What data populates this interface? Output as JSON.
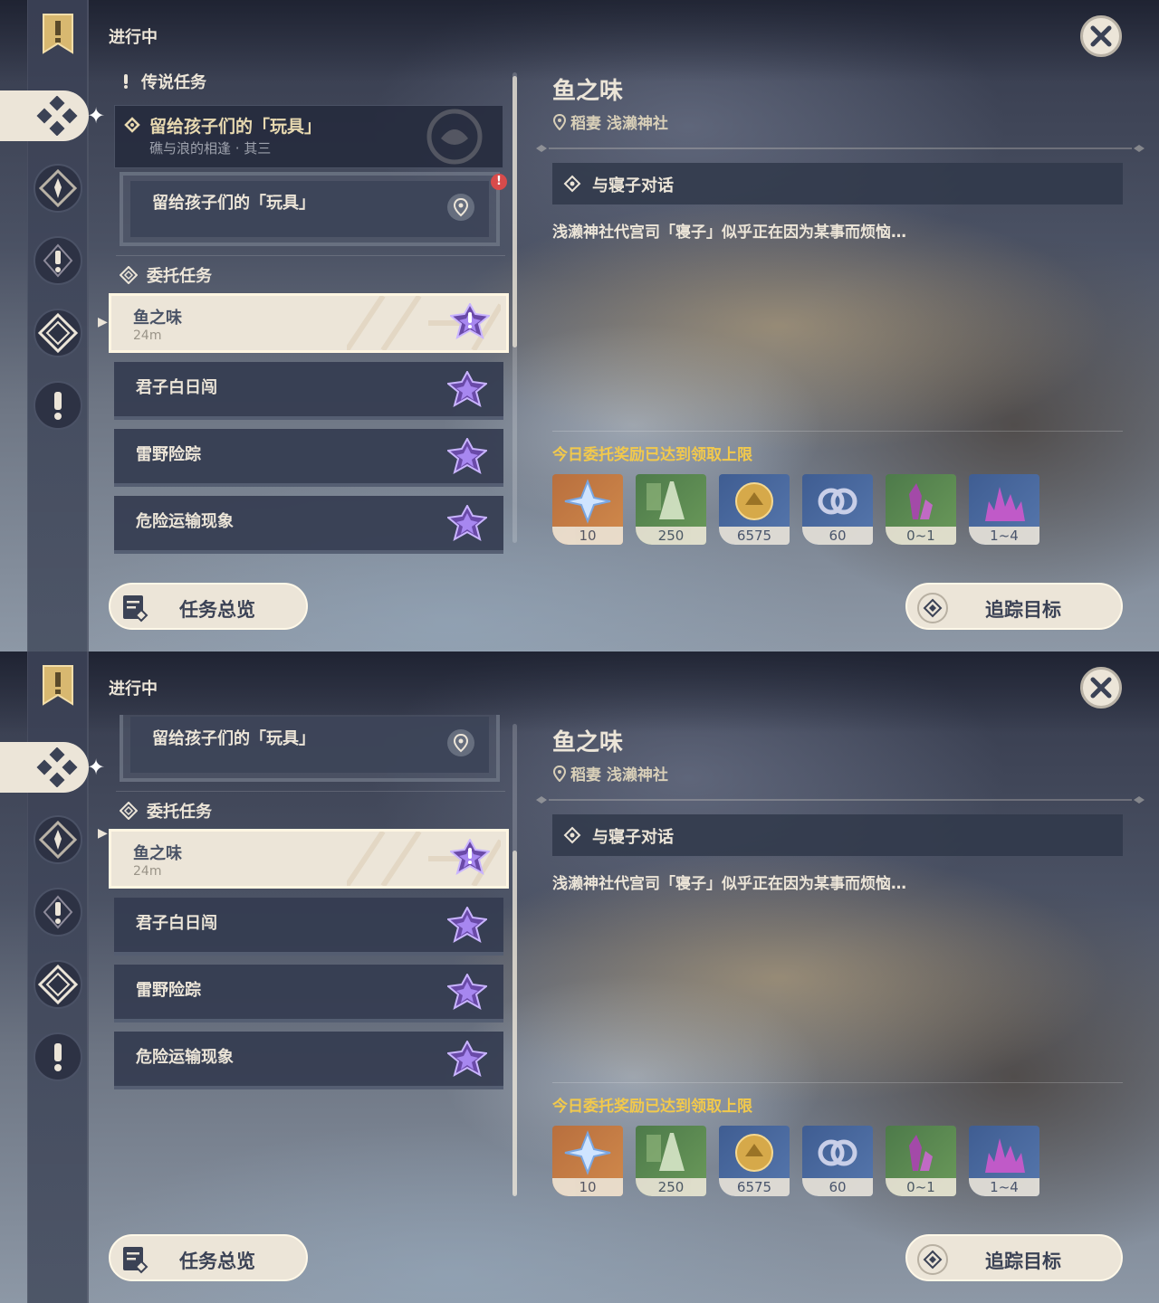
{
  "status_label": "进行中",
  "legend_section": {
    "heading": "传说任务",
    "quest_title": "留给孩子们的「玩具」",
    "quest_subtitle": "礁与浪的相逢 · 其三",
    "sub_objective": "留给孩子们的「玩具」",
    "alert_mark": "!"
  },
  "commission_section": {
    "heading": "委托任务",
    "items": [
      {
        "name": "鱼之味",
        "distance": "24m",
        "selected": true
      },
      {
        "name": "君子白日闯"
      },
      {
        "name": "雷野险踪"
      },
      {
        "name": "危险运输现象"
      }
    ]
  },
  "detail": {
    "title": "鱼之味",
    "location": "稻妻 浅濑神社",
    "objective": "与寝子对话",
    "description": "浅濑神社代宫司「寝子」似乎正在因为某事而烦恼…",
    "reward_note": "今日委托奖励已达到领取上限",
    "rewards": [
      {
        "count": "10",
        "icon": "primogem-icon",
        "rarity_color": "#c07a44"
      },
      {
        "count": "250",
        "icon": "adventure-exp-icon",
        "rarity_color": "#5a8a52"
      },
      {
        "count": "6575",
        "icon": "mora-icon",
        "rarity_color": "#4a6aa0"
      },
      {
        "count": "60",
        "icon": "friendship-exp-icon",
        "rarity_color": "#4a6aa0"
      },
      {
        "count": "0~1",
        "icon": "crystal-chunk-icon",
        "rarity_color": "#5a8a52"
      },
      {
        "count": "1~4",
        "icon": "crystal-cluster-icon",
        "rarity_color": "#4a6aa0"
      }
    ]
  },
  "buttons": {
    "overview": "任务总览",
    "track": "追踪目标"
  },
  "colors": {
    "accent_cream": "#ece5d8",
    "highlight_yellow": "#f2c94c",
    "badge_purple": "#8a5cc8",
    "alert_red": "#d84b4b"
  }
}
